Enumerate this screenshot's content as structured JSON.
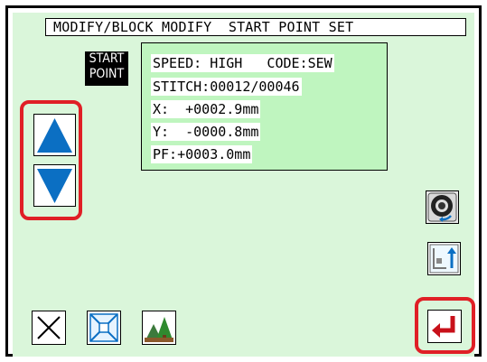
{
  "header": {
    "title": "MODIFY/BLOCK MODIFY  START POINT SET"
  },
  "start_label": {
    "line1": "START",
    "line2": "POINT"
  },
  "info": {
    "speed": "SPEED: HIGH   CODE:SEW",
    "stitch": "STITCH:00012/00046",
    "x": "X:  +0002.9mm",
    "y": "Y:  -0000.8mm",
    "pf": "PF:+0003.0mm"
  },
  "icons": {
    "up": "up-arrow-icon",
    "down": "down-arrow-icon",
    "wheel": "handwheel-icon",
    "origin": "return-origin-icon",
    "cancel": "cancel-x-icon",
    "fit": "zoom-fit-icon",
    "image": "image-view-icon",
    "enter": "enter-icon"
  },
  "colors": {
    "screen_bg": "#daf6da",
    "panel_bg": "#bff5bf",
    "arrow_blue": "#0b6fc3",
    "highlight_red": "#e01f26",
    "enter_red": "#c8101a"
  }
}
